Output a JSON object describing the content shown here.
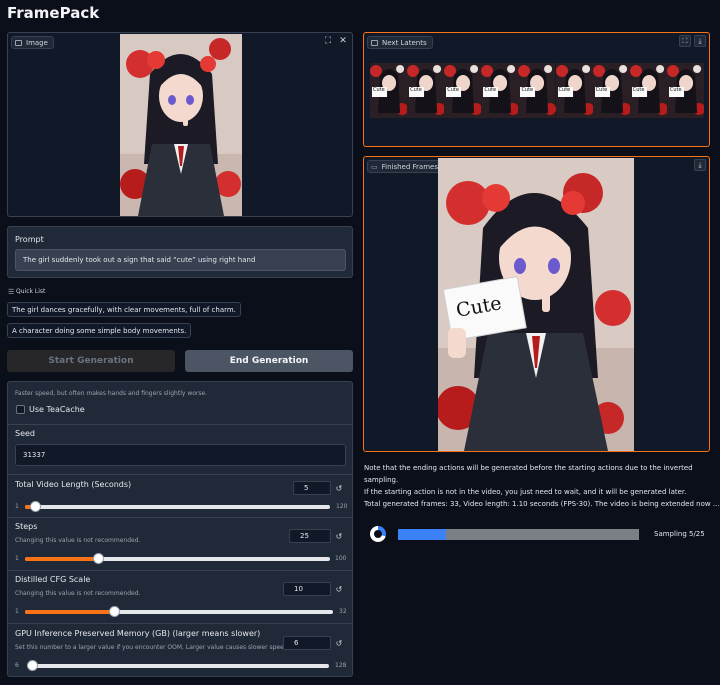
{
  "app": {
    "title": "FramePack"
  },
  "image_panel": {
    "label": "Image",
    "icons": [
      "fullscreen-icon",
      "close-icon"
    ]
  },
  "prompt": {
    "label": "Prompt",
    "value": "The girl suddenly took out a sign that said “cute” using right hand"
  },
  "quick_list": {
    "label": "Quick List",
    "items": [
      "The girl dances gracefully, with clear movements, full of charm.",
      "A character doing some simple body movements."
    ]
  },
  "buttons": {
    "start": "Start Generation",
    "end": "End Generation"
  },
  "settings": {
    "teacache_hint": "Faster speed, but often makes hands and fingers slightly worse.",
    "teacache_label": "Use TeaCache",
    "teacache_checked": false,
    "seed_label": "Seed",
    "seed_value": "31337",
    "sliders": [
      {
        "label": "Total Video Length (Seconds)",
        "hint": "",
        "value": "5",
        "min": "1",
        "max": "120",
        "fraction": 0.034
      },
      {
        "label": "Steps",
        "hint": "Changing this value is not recommended.",
        "value": "25",
        "min": "1",
        "max": "100",
        "fraction": 0.24
      },
      {
        "label": "Distilled CFG Scale",
        "hint": "Changing this value is not recommended.",
        "value": "10",
        "min": "1",
        "max": "32",
        "fraction": 0.29
      },
      {
        "label": "GPU Inference Preserved Memory (GB) (larger means slower)",
        "hint": "Set this number to a larger value if you encounter OOM. Larger value causes slower speed.",
        "value": "6",
        "min": "6",
        "max": "128",
        "fraction": 0.0
      }
    ]
  },
  "next_latents": {
    "label": "Next Latents",
    "icons": [
      "fullscreen-icon",
      "download-icon"
    ],
    "frame_sign_text": "Cute",
    "frame_count": 9
  },
  "finished_frames": {
    "label": "Finished Frames",
    "icons": [
      "download-icon"
    ],
    "sign_text": "Cute"
  },
  "notes": {
    "line1": "Note that the ending actions will be generated before the starting actions due to the inverted sampling.",
    "line2": "If the starting action is not in the video, you just need to wait, and it will be generated later.",
    "status": "Total generated frames: 33, Video length: 1.10 seconds (FPS-30). The video is being extended now ..."
  },
  "progress": {
    "label": "Sampling 5/25",
    "fraction": 0.2
  },
  "colors": {
    "accent": "#f97316",
    "progress": "#3b82f6",
    "background": "#0b0f19",
    "panel": "#1f2937"
  }
}
